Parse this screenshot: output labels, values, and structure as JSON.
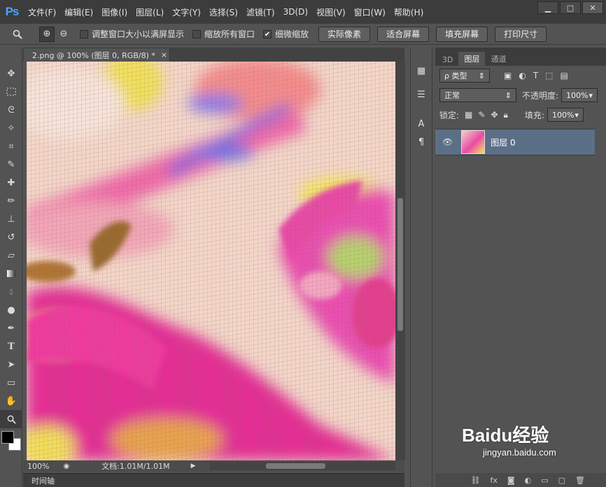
{
  "app": {
    "logo": "Ps"
  },
  "menu": [
    "文件(F)",
    "编辑(E)",
    "图像(I)",
    "图层(L)",
    "文字(Y)",
    "选择(S)",
    "滤镜(T)",
    "3D(D)",
    "视图(V)",
    "窗口(W)",
    "帮助(H)"
  ],
  "window_controls": {
    "minimize": "▁",
    "maximize": "□",
    "close": "✕"
  },
  "options": {
    "zoom_tool_icon": "magnifier-icon",
    "resize_windows": "调整窗口大小以满屏显示",
    "zoom_all": "缩放所有窗口",
    "scrubby_zoom": "细微缩放",
    "scrubby_checked": "✔",
    "actual_pixels": "实际像素",
    "fit_screen": "适合屏幕",
    "fill_screen": "填充屏幕",
    "print_size": "打印尺寸"
  },
  "document": {
    "tab_title": "2.png @ 100% (图层 0, RGB/8) *",
    "close": "×"
  },
  "status": {
    "zoom": "100%",
    "doc_info": "文档:1.01M/1.01M"
  },
  "timeline": {
    "label": "时间轴"
  },
  "panel": {
    "tabs": [
      "3D",
      "图层",
      "通道"
    ],
    "filter_label": "ρ 类型",
    "blend_mode": "正常",
    "opacity_label": "不透明度:",
    "opacity_value": "100%",
    "lock_label": "锁定:",
    "fill_label": "填充:",
    "fill_value": "100%",
    "layer_name": "图层 0"
  },
  "watermark": {
    "text": "Baidu经验",
    "url": "jingyan.baidu.com"
  },
  "colors": {
    "accent": "#4aa3ff",
    "selected_layer": "#5b6f87"
  }
}
